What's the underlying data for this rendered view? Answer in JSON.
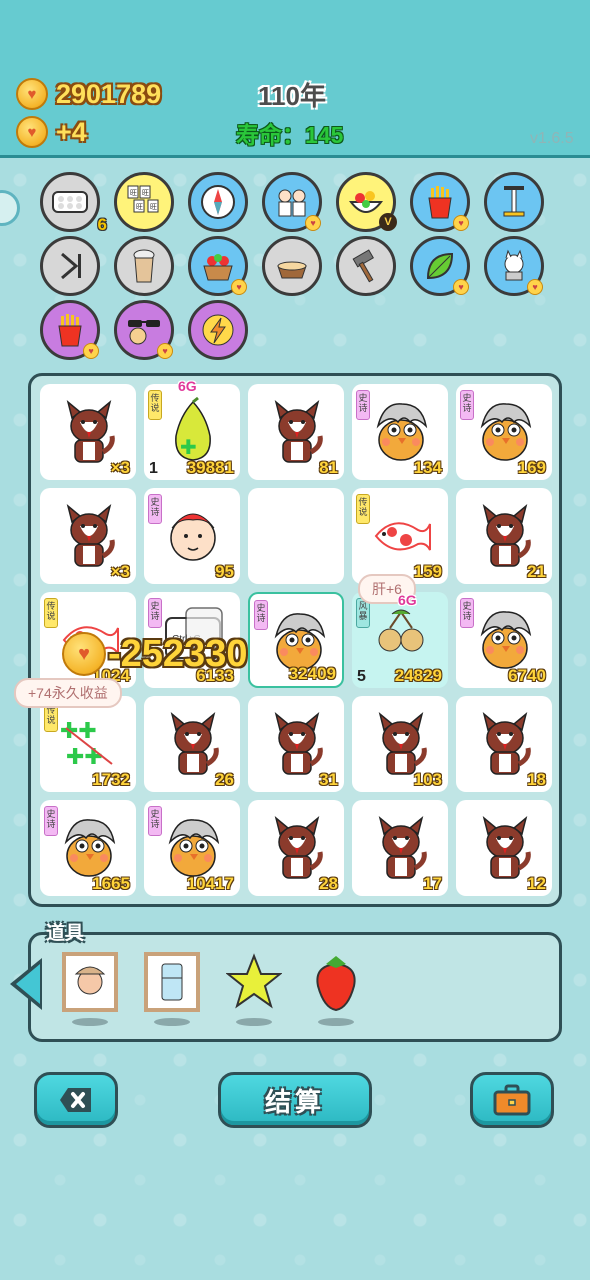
{
  "header": {
    "coins": "2901789",
    "income": "+4",
    "year": "110年",
    "life": "寿命：145",
    "version": "v1.6.5"
  },
  "items_row1": [
    {
      "name": "egg-tray-icon",
      "color": "gray",
      "count": "6"
    },
    {
      "name": "mahjong-icon",
      "color": "yellow"
    },
    {
      "name": "compass-icon",
      "color": "blue"
    },
    {
      "name": "couple-icon",
      "color": "blue"
    },
    {
      "name": "fruit-bowl-icon",
      "color": "yellow"
    },
    {
      "name": "fries-icon",
      "color": "blue"
    },
    {
      "name": "pump-icon",
      "color": "blue"
    }
  ],
  "items_row2": [
    {
      "name": "skip-icon",
      "color": "gray"
    },
    {
      "name": "milk-tea-icon",
      "color": "gray"
    },
    {
      "name": "fruit-basket-icon",
      "color": "blue"
    },
    {
      "name": "dog-bowl-icon",
      "color": "gray"
    },
    {
      "name": "hammer-icon",
      "color": "gray"
    },
    {
      "name": "leaf-icon",
      "color": "blue"
    },
    {
      "name": "dog-toy-icon",
      "color": "blue"
    }
  ],
  "items_row3": [
    {
      "name": "fries-icon",
      "color": "purple"
    },
    {
      "name": "sunglasses-icon",
      "color": "purple"
    },
    {
      "name": "lightning-icon",
      "color": "purple"
    }
  ],
  "board": {
    "cells": [
      {
        "sprite": "husky",
        "num": "×3"
      },
      {
        "sprite": "pomelo",
        "num": "39881",
        "tag": "传说",
        "tagcolor": "yellow",
        "lnum": "1"
      },
      {
        "sprite": "husky",
        "num": "81"
      },
      {
        "sprite": "chick",
        "num": "134",
        "tag": "史诗",
        "tagcolor": "pink"
      },
      {
        "sprite": "chick",
        "num": "169",
        "tag": "史诗",
        "tagcolor": "pink"
      },
      {
        "sprite": "husky",
        "num": "×3"
      },
      {
        "sprite": "boy",
        "num": "95",
        "tag": "史诗",
        "tagcolor": "pink"
      },
      {
        "sprite": "empty",
        "num": ""
      },
      {
        "sprite": "koi",
        "num": "159",
        "tag": "传说",
        "tagcolor": "yellow"
      },
      {
        "sprite": "husky",
        "num": "21"
      },
      {
        "sprite": "koi",
        "num": "1024",
        "tag": "传说",
        "tagcolor": "yellow"
      },
      {
        "sprite": "keyboard",
        "num": "6133",
        "tag": "史诗",
        "tagcolor": "pink"
      },
      {
        "sprite": "chick",
        "num": "32409",
        "tag": "史诗",
        "tagcolor": "pink"
      },
      {
        "sprite": "longan",
        "num": "24829",
        "tag": "风暴",
        "tagcolor": "teal",
        "lnum": "5"
      },
      {
        "sprite": "chick",
        "num": "6740",
        "tag": "史诗",
        "tagcolor": "pink"
      },
      {
        "sprite": "clover",
        "num": "1732",
        "tag": "传说",
        "tagcolor": "yellow"
      },
      {
        "sprite": "husky",
        "num": "26"
      },
      {
        "sprite": "husky",
        "num": "31"
      },
      {
        "sprite": "husky",
        "num": "103"
      },
      {
        "sprite": "husky",
        "num": "18"
      },
      {
        "sprite": "chick",
        "num": "1665",
        "tag": "史诗",
        "tagcolor": "pink"
      },
      {
        "sprite": "chick",
        "num": "10417",
        "tag": "史诗",
        "tagcolor": "pink"
      },
      {
        "sprite": "husky",
        "num": "28"
      },
      {
        "sprite": "husky",
        "num": "17"
      },
      {
        "sprite": "husky",
        "num": "12"
      }
    ]
  },
  "floats": {
    "gain": "-252330",
    "bonus": "+74永久收益",
    "liver": "肝+6",
    "sixg": "6G",
    "sixg2": "6G"
  },
  "props": {
    "title": "道具",
    "items": [
      "grandpa-portrait-icon",
      "fridge-portrait-icon",
      "star-icon",
      "strawberry-icon"
    ]
  },
  "buttons": {
    "settle": "结算"
  }
}
